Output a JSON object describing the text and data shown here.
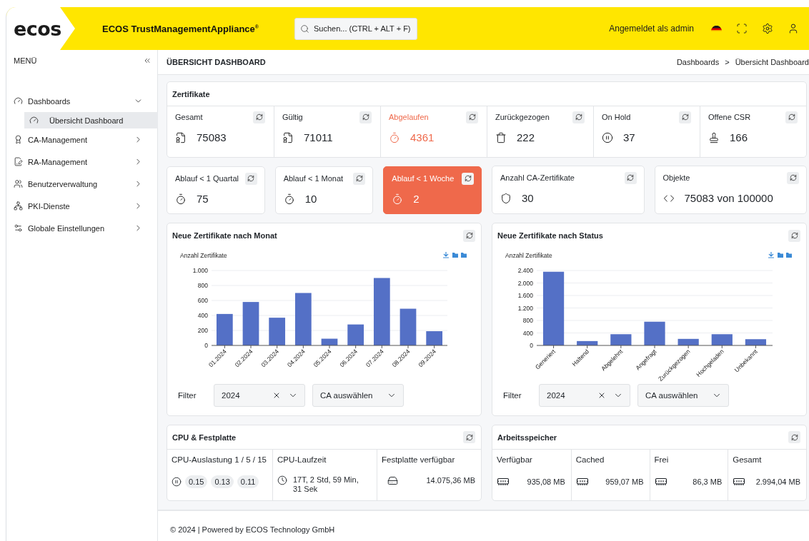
{
  "header": {
    "logo": "ecos",
    "title": "ECOS TrustManagementAppliance$^{®}$",
    "search": {
      "placeholder": "Suchen... (CTRL + ALT + F)"
    },
    "user_label": "Angemeldet als admin"
  },
  "sidebar": {
    "heading": "MENÜ",
    "items": [
      {
        "label": "Dashboards",
        "kind": "dashboards",
        "expanded": true,
        "children": [
          {
            "label": "Übersicht Dashboard",
            "selected": true
          }
        ]
      },
      {
        "label": "CA-Management",
        "kind": "ca",
        "expanded": false
      },
      {
        "label": "RA-Management",
        "kind": "ra",
        "expanded": false
      },
      {
        "label": "Benutzerverwaltung",
        "kind": "users",
        "expanded": false
      },
      {
        "label": "PKI-Dienste",
        "kind": "pki",
        "expanded": false
      },
      {
        "label": "Globale Einstellungen",
        "kind": "settings",
        "expanded": false
      }
    ]
  },
  "page": {
    "title": "ÜBERSICHT DASHBOARD",
    "breadcrumb": [
      "Dashboards",
      "Übersicht Dashboard"
    ],
    "separator": ">"
  },
  "certificates": {
    "title": "Zertifikate",
    "stats": [
      {
        "label": "Gesamt",
        "value": "75083",
        "kind": "total",
        "alert": false
      },
      {
        "label": "Gültig",
        "value": "71011",
        "kind": "valid",
        "alert": false
      },
      {
        "label": "Abgelaufen",
        "value": "4361",
        "kind": "expired",
        "alert": true
      },
      {
        "label": "Zurückgezogen",
        "value": "222",
        "kind": "revoked",
        "alert": false
      },
      {
        "label": "On Hold",
        "value": "37",
        "kind": "hold",
        "alert": false
      },
      {
        "label": "Offene CSR",
        "value": "166",
        "kind": "csr",
        "alert": false
      }
    ]
  },
  "expiry": [
    {
      "label": "Ablauf < 1 Quartal",
      "value": "75",
      "kind": "expiry",
      "alert": false
    },
    {
      "label": "Ablauf < 1 Monat",
      "value": "10",
      "kind": "expiry",
      "alert": false
    },
    {
      "label": "Ablauf < 1 Woche",
      "value": "2",
      "kind": "expiry",
      "alert": true
    }
  ],
  "counters": [
    {
      "label": "Anzahl CA-Zertifikate",
      "value": "30",
      "kind": "ca"
    },
    {
      "label": "Objekte",
      "value": "75083 von 100000",
      "kind": "objects"
    }
  ],
  "charts": [
    {
      "title": "Neue Zertifikate nach Monat",
      "filter": {
        "label": "Filter",
        "year": "2024",
        "ca_placeholder": "CA auswählen"
      },
      "chart_data": {
        "type": "bar",
        "ylabel": "Anzahl Zertifikate",
        "categories": [
          "01.2024",
          "02.2024",
          "03.2024",
          "04.2024",
          "05.2024",
          "06.2024",
          "07.2024",
          "08.2024",
          "09.2024"
        ],
        "series": [
          {
            "color": "#5470c6",
            "values": [
              420,
              580,
              370,
              700,
              90,
              280,
              900,
              490,
              190
            ]
          }
        ],
        "grid": true,
        "ylim": [
          0,
          1000
        ],
        "yticks": [
          0,
          200,
          400,
          600,
          800,
          {
            "value": 1000,
            "label": "1.000"
          }
        ]
      }
    },
    {
      "title": "Neue Zertifikate nach Status",
      "filter": {
        "label": "Filter",
        "year": "2024",
        "ca_placeholder": "CA auswählen"
      },
      "chart_data": {
        "type": "bar",
        "ylabel": "Anzahl Zertifikate",
        "categories": [
          "Generiert",
          "Haltend",
          "Abgelehnt",
          "Angefragt",
          "Zurückgezogen",
          "Hochgeladen",
          "Unbekannt"
        ],
        "series": [
          {
            "color": "#5470c6",
            "values": [
              2360,
              140,
              360,
              760,
              210,
              360,
              200
            ]
          }
        ],
        "grid": true,
        "ylim": [
          0,
          2400
        ],
        "yticks": [
          0,
          400,
          800,
          {
            "value": 1200,
            "label": "1.200"
          },
          {
            "value": 1600,
            "label": "1.600"
          },
          {
            "value": 2000,
            "label": "2.000"
          },
          {
            "value": 2400,
            "label": "2.400"
          }
        ]
      }
    }
  ],
  "cpu": {
    "title": "CPU & Festplatte",
    "cells": [
      {
        "kind": "load",
        "label": "CPU-Auslastung 1 / 5 / 15",
        "values": [
          "0.15",
          "0.13",
          "0.11"
        ]
      },
      {
        "kind": "uptime",
        "label": "CPU-Laufzeit",
        "value": "17T, 2 Std, 59 Min, 31 Sek"
      },
      {
        "kind": "disk",
        "label": "Festplatte verfügbar",
        "value": "14.075,36 MB"
      }
    ]
  },
  "memory": {
    "title": "Arbeitsspeicher",
    "cells": [
      {
        "label": "Verfügbar",
        "value": "935,08 MB"
      },
      {
        "label": "Cached",
        "value": "959,07 MB"
      },
      {
        "label": "Frei",
        "value": "86,3 MB"
      },
      {
        "label": "Gesamt",
        "value": "2.994,04 MB"
      }
    ]
  },
  "footer": "© 2024 | Powered by ECOS Technology GmbH"
}
